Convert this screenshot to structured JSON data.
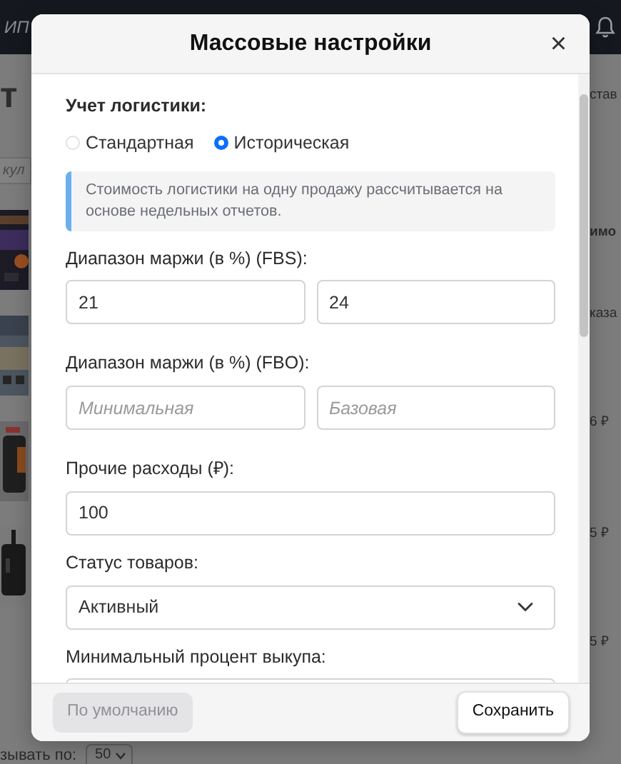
{
  "background": {
    "brand": "ИП",
    "heading": "т",
    "search_fragment": "кул",
    "column_fragments": [
      "став",
      "имо",
      "каза",
      "6 ₽",
      "5 ₽",
      "5 ₽"
    ],
    "page_size_label": "зывать по:",
    "page_size": "50"
  },
  "modal": {
    "title": "Массовые настройки",
    "close": "×",
    "logistics": {
      "label": "Учет логистики:",
      "options": [
        {
          "label": "Стандартная",
          "selected": false
        },
        {
          "label": "Историческая",
          "selected": true
        }
      ]
    },
    "note": "Стоимость логистики на одну продажу рассчитывается на основе недельных отчетов.",
    "fields": [
      {
        "kind": "range",
        "label": "Диапазон маржи (в %) (FBS):",
        "inputs": [
          {
            "value": "21"
          },
          {
            "value": "24"
          }
        ]
      },
      {
        "kind": "range",
        "label": "Диапазон маржи (в %) (FBO):",
        "inputs": [
          {
            "placeholder": "Минимальная"
          },
          {
            "placeholder": "Базовая"
          }
        ]
      },
      {
        "kind": "text",
        "label": "Прочие расходы (₽):",
        "value": "100"
      },
      {
        "kind": "select",
        "label": "Статус товаров:",
        "value": "Активный"
      },
      {
        "kind": "text",
        "label": "Минимальный процент выкупа:"
      }
    ],
    "buttons": [
      {
        "label": "По умолчанию",
        "disabled": true
      },
      {
        "label": "Сохранить",
        "disabled": false
      }
    ]
  }
}
